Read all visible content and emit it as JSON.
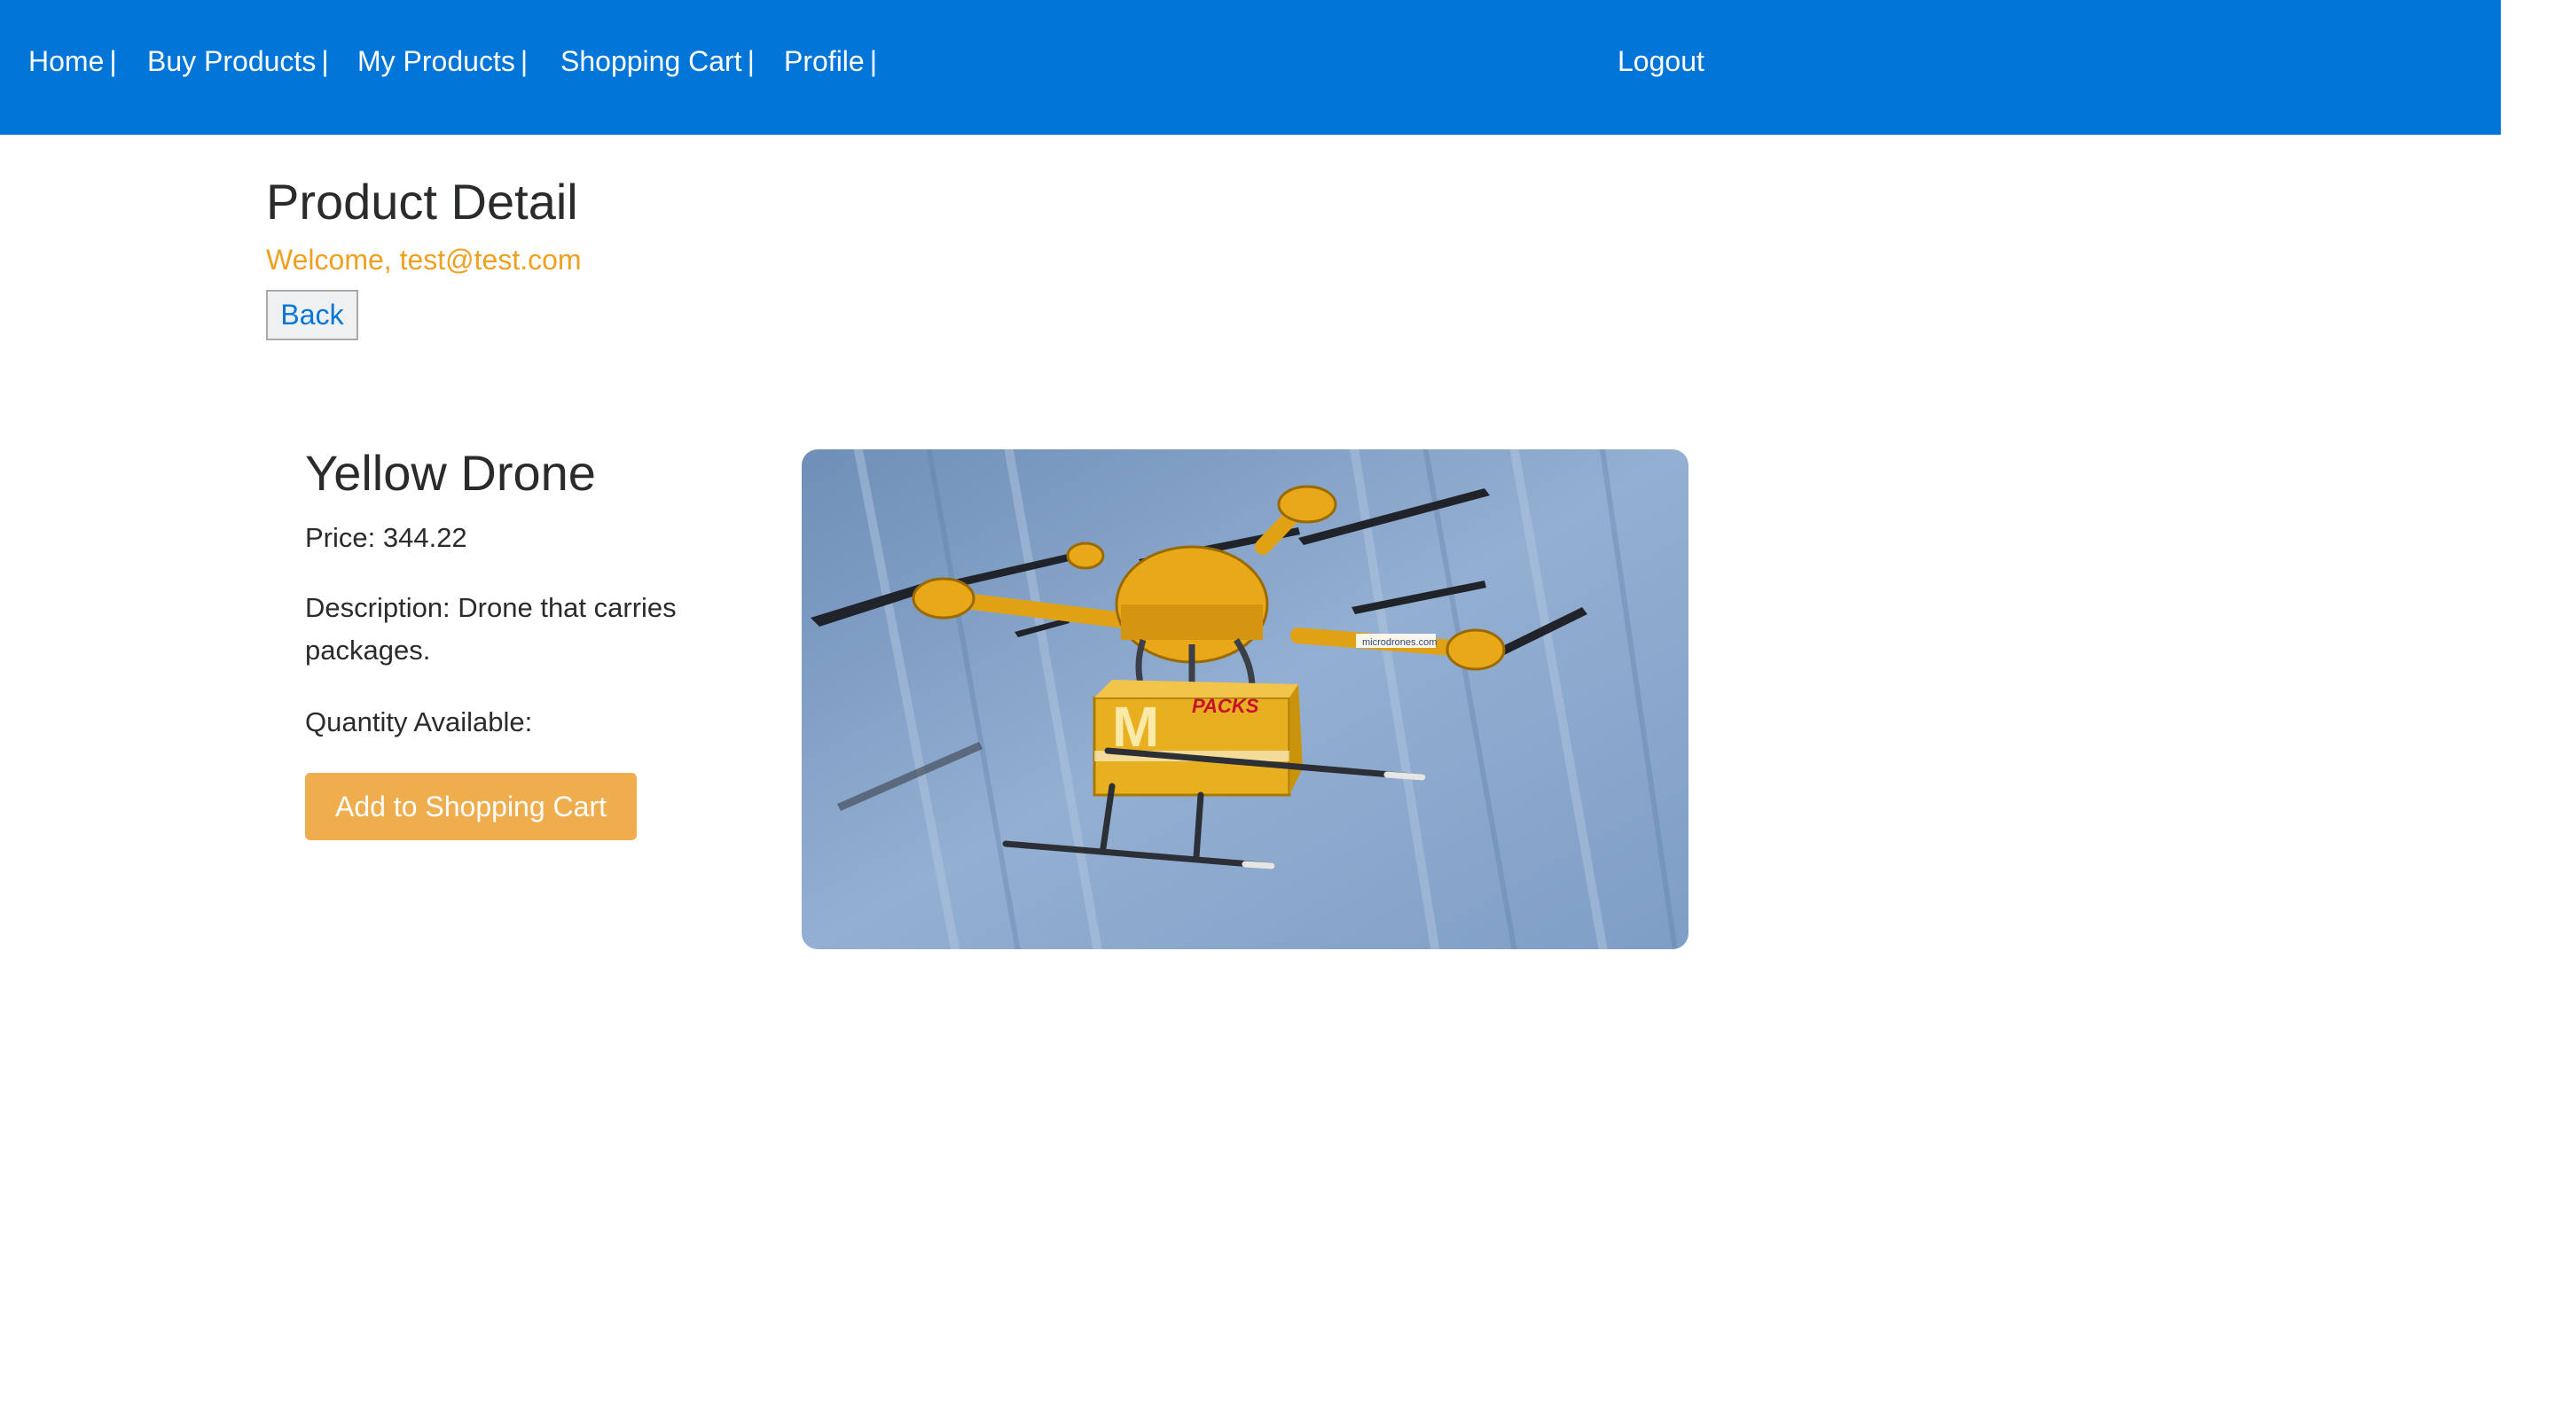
{
  "nav": {
    "home": "Home",
    "buy_products": "Buy Products",
    "my_products": "My Products",
    "shopping_cart": "Shopping Cart",
    "profile": "Profile",
    "separator": "|",
    "logout": "Logout"
  },
  "page": {
    "title": "Product Detail",
    "welcome": "Welcome, test@test.com",
    "back_label": "Back"
  },
  "product": {
    "name": "Yellow Drone",
    "price_text": "Price: 344.22",
    "description_text": "Description: Drone that carries packages.",
    "quantity_text": "Quantity Available:",
    "add_to_cart_label": "Add to Shopping Cart",
    "image_alt": "Yellow Drone",
    "image_text": {
      "box_letter": "M",
      "box_brand": "PACKS",
      "arm_label": "microdrones.com"
    }
  },
  "colors": {
    "navbar": "#0275d8",
    "welcome": "#f0a020",
    "add_button": "#f0ad4e",
    "link": "#0275d8",
    "drone_yellow": "#e8a817"
  }
}
